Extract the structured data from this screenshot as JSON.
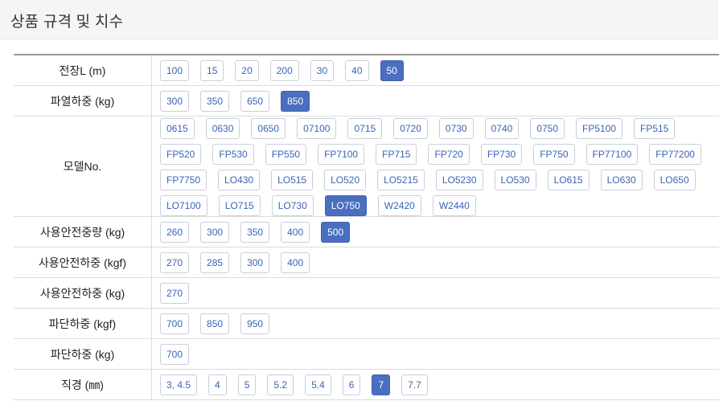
{
  "header": {
    "title": "상품 규격 및 치수"
  },
  "accent_color": "#4a6fc0",
  "rows": [
    {
      "label": "전장L (m)",
      "options": [
        "100",
        "15",
        "20",
        "200",
        "30",
        "40",
        "50"
      ],
      "selected": "50"
    },
    {
      "label": "파열하중 (kg)",
      "options": [
        "300",
        "350",
        "650",
        "850"
      ],
      "selected": "850"
    },
    {
      "label": "모델No.",
      "options": [
        "0615",
        "0630",
        "0650",
        "07100",
        "0715",
        "0720",
        "0730",
        "0740",
        "0750",
        "FP5100",
        "FP515",
        "FP520",
        "FP530",
        "FP550",
        "FP7100",
        "FP715",
        "FP720",
        "FP730",
        "FP750",
        "FP77100",
        "FP77200",
        "FP7750",
        "LO430",
        "LO515",
        "LO520",
        "LO5215",
        "LO5230",
        "LO530",
        "LO615",
        "LO630",
        "LO650",
        "LO7100",
        "LO715",
        "LO730",
        "LO750",
        "W2420",
        "W2440"
      ],
      "selected": "LO750"
    },
    {
      "label": "사용안전중량 (kg)",
      "options": [
        "260",
        "300",
        "350",
        "400",
        "500"
      ],
      "selected": "500"
    },
    {
      "label": "사용안전하중 (kgf)",
      "options": [
        "270",
        "285",
        "300",
        "400"
      ],
      "selected": ""
    },
    {
      "label": "사용안전하중 (kg)",
      "options": [
        "270"
      ],
      "selected": ""
    },
    {
      "label": "파단하중 (kgf)",
      "options": [
        "700",
        "850",
        "950"
      ],
      "selected": ""
    },
    {
      "label": "파단하중 (kg)",
      "options": [
        "700"
      ],
      "selected": ""
    },
    {
      "label": "직경 (㎜)",
      "options": [
        "3, 4.5",
        "4",
        "5",
        "5.2",
        "5.4",
        "6",
        "7",
        "7.7"
      ],
      "selected": "7"
    }
  ]
}
